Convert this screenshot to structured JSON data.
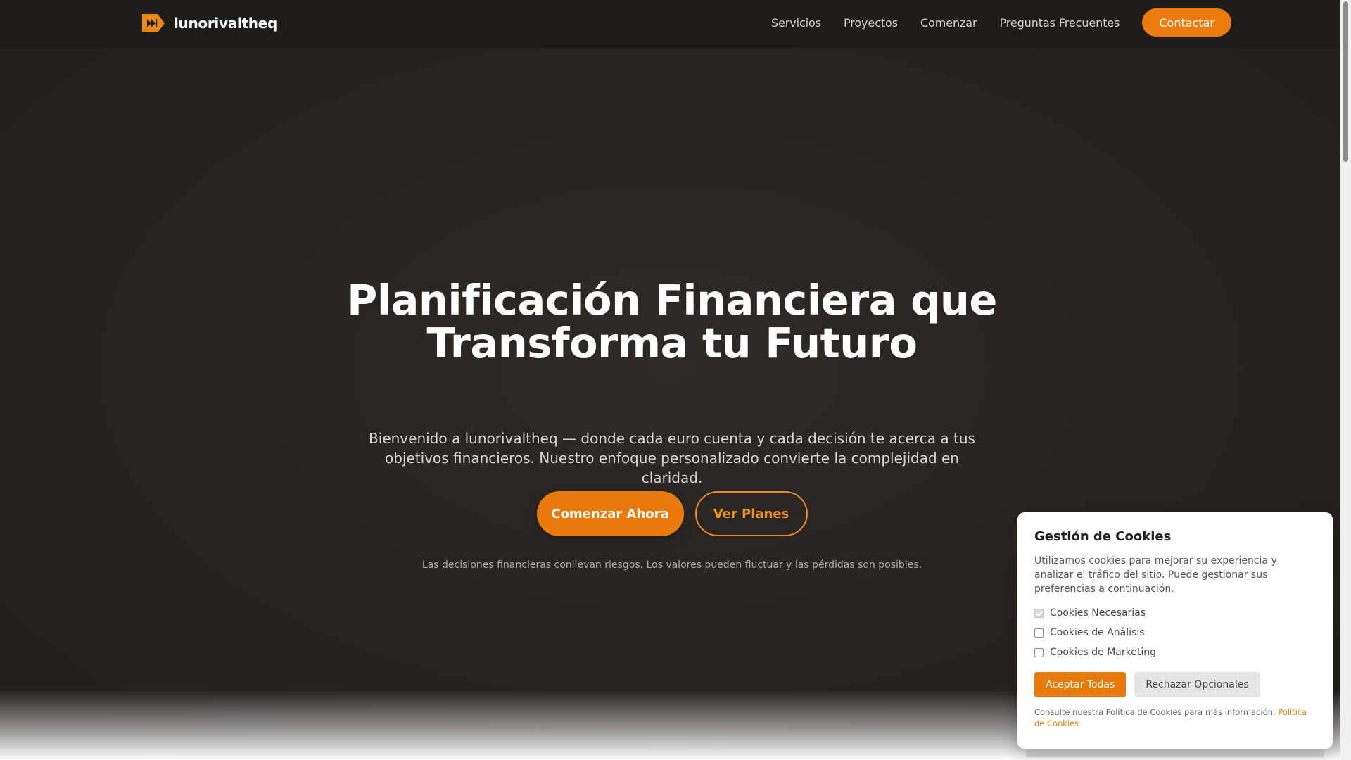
{
  "nav": {
    "brand": "lunorivaltheq",
    "links": [
      "Servicios",
      "Proyectos",
      "Comenzar",
      "Preguntas Frecuentes"
    ],
    "cta": "Contactar"
  },
  "hero": {
    "title_line1": "Planificación Financiera que",
    "title_line2": "Transforma tu Futuro",
    "subtitle": "Bienvenido a lunorivaltheq — donde cada euro cuenta y cada decisión te acerca a tus objetivos financieros. Nuestro enfoque personalizado convierte la complejidad en claridad.",
    "primary_button": "Comenzar Ahora",
    "secondary_button": "Ver Planes",
    "disclaimer": "Las decisiones financieras conllevan riesgos. Los valores pueden fluctuar y las pérdidas son posibles."
  },
  "cookies": {
    "title": "Gestión de Cookies",
    "description": "Utilizamos cookies para mejorar su experiencia y analizar el tráfico del sitio. Puede gestionar sus preferencias a continuación.",
    "options": [
      {
        "label": "Cookies Necesarias",
        "checked": true
      },
      {
        "label": "Cookies de Análisis",
        "checked": false
      },
      {
        "label": "Cookies de Marketing",
        "checked": false
      }
    ],
    "accept": "Aceptar Todas",
    "reject": "Rechazar Opcionales",
    "footer_text": "Consulte nuestra Política de Cookies para más información.",
    "footer_link": "Política de Cookies"
  },
  "colors": {
    "accent": "#e87a0b",
    "nav_bg": "#1e1c1b",
    "hero_bg": "#262321"
  },
  "icons": {
    "logo": "fast-forward-logo-icon"
  }
}
